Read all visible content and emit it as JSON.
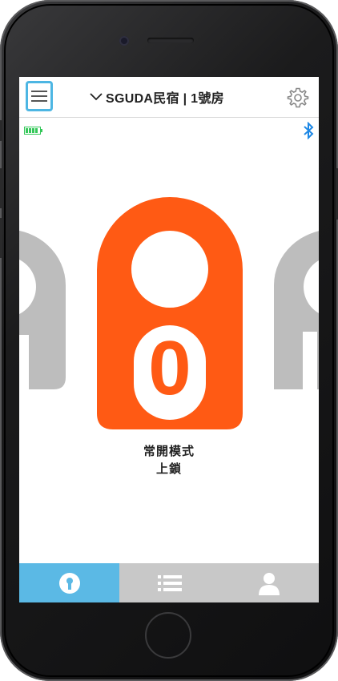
{
  "header": {
    "title": "SGUDA民宿 | 1號房"
  },
  "lock": {
    "status_mode": "常開模式",
    "status_state": "上鎖",
    "main_tag_letter": "0",
    "main_color": "#FF5A14",
    "side_color": "#BDBDBD"
  },
  "tabs": [
    {
      "icon": "key-icon",
      "active": true
    },
    {
      "icon": "list-icon",
      "active": false
    },
    {
      "icon": "user-icon",
      "active": false
    }
  ],
  "colors": {
    "accent": "#5BB9E5",
    "bluetooth": "#1E88E5",
    "battery": "#34C759"
  }
}
